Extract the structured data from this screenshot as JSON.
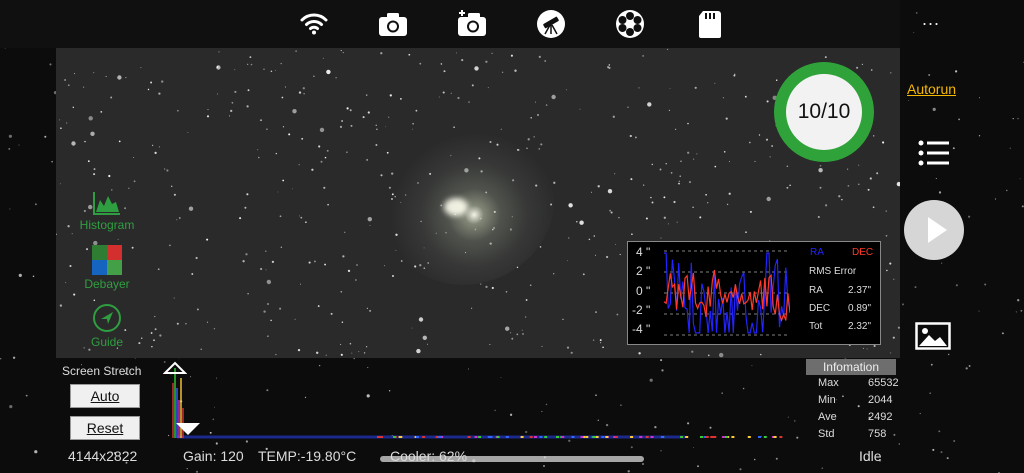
{
  "toolbar": {
    "icons": [
      "wifi-icon",
      "camera-icon",
      "camera-add-icon",
      "telescope-icon",
      "filter-wheel-icon",
      "sd-card-icon"
    ],
    "more": "..."
  },
  "left_tools": [
    {
      "label": "Histogram",
      "icon": "histogram-icon"
    },
    {
      "label": "Debayer",
      "icon": "debayer-icon"
    },
    {
      "label": "Guide",
      "icon": "guide-icon"
    }
  ],
  "capture": {
    "progress_text": "10/10",
    "progress_fraction": 1.0,
    "ring_color": "#2fa33a"
  },
  "side": {
    "autorun_label": "Autorun",
    "autorun_color": "#f5b800"
  },
  "guide_graph": {
    "y_labels": [
      "4 \"",
      "2 \"",
      "0 \"",
      "-2 \"",
      "-4 \""
    ],
    "legend_ra": "RA",
    "legend_dec": "DEC",
    "ra_color": "#2323ff",
    "dec_color": "#ff3a2a",
    "rms_title": "RMS Error",
    "rows": [
      {
        "label": "RA",
        "value": "2.37\""
      },
      {
        "label": "DEC",
        "value": "0.89\""
      },
      {
        "label": "Tot",
        "value": "2.32\""
      }
    ]
  },
  "stretch": {
    "title": "Screen Stretch",
    "auto_label": "Auto",
    "reset_label": "Reset"
  },
  "info": {
    "header": "Infomation",
    "rows": [
      {
        "label": "Max",
        "value": "65532"
      },
      {
        "label": "Min",
        "value": "2044"
      },
      {
        "label": "Ave",
        "value": "2492"
      },
      {
        "label": "Std",
        "value": "758"
      }
    ]
  },
  "status": {
    "resolution": "4144x2822",
    "gain": "Gain: 120",
    "temp": "TEMP:-19.80°C",
    "cooler": "Cooler: 62%",
    "state": "Idle"
  }
}
